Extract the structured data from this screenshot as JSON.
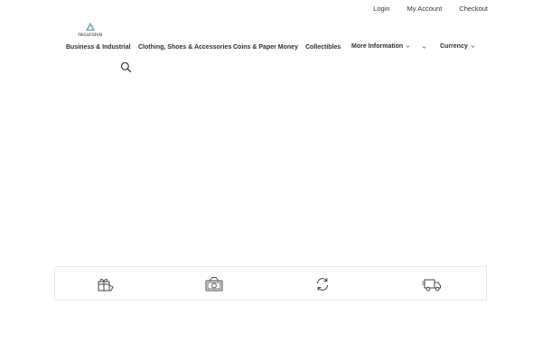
{
  "header": {
    "top_links": [
      {
        "label": "Login"
      },
      {
        "label": "My Account"
      },
      {
        "label": "Checkout"
      }
    ],
    "logo": {
      "text": "recursive",
      "icon": "triangle-logo-icon",
      "color": "#7aaabc"
    }
  },
  "nav": {
    "items": [
      {
        "label": "Business & Industrial"
      },
      {
        "label": "Clothing, Shoes & Accessories"
      },
      {
        "label": "Coins & Paper Money"
      },
      {
        "label": "Collectibles"
      },
      {
        "label": "More Information"
      },
      {
        "label": ""
      },
      {
        "label": "Currency"
      }
    ],
    "search_icon": "search-icon"
  },
  "features": {
    "icons": [
      "gift-icon",
      "money-icon",
      "refresh-icon",
      "delivery-truck-icon"
    ]
  }
}
